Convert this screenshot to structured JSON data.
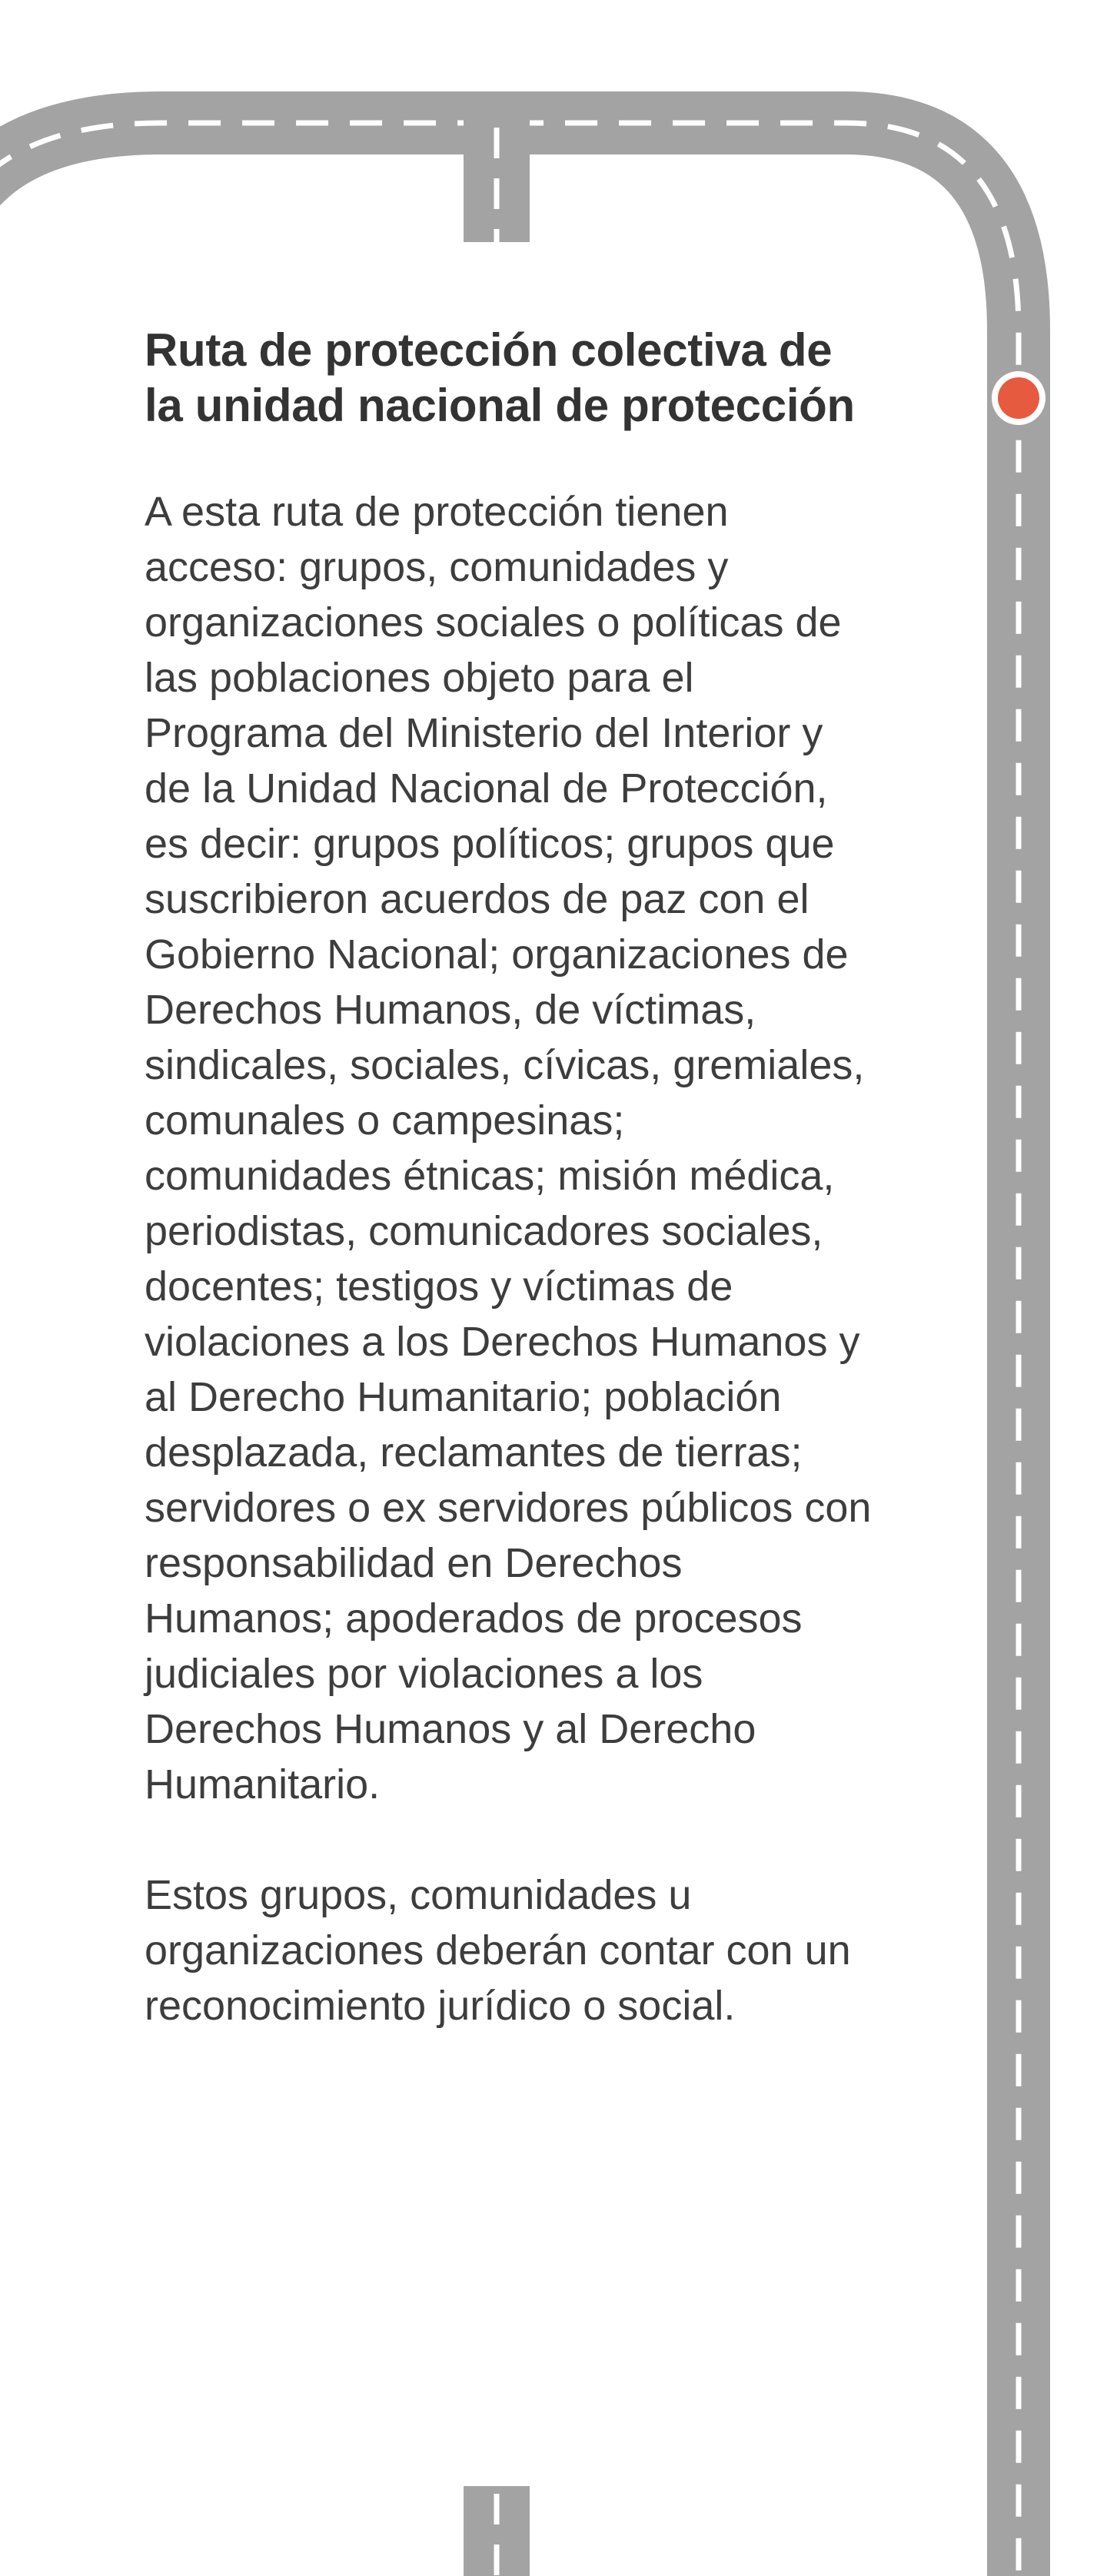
{
  "section": {
    "title": "Ruta de protección colectiva de la unidad nacional de protección",
    "paragraphs": [
      "A esta ruta de protección tienen acceso: grupos, comunidades y organizaciones sociales o políticas de las poblaciones objeto para el Programa del Ministerio del Interior y de la Unidad Nacional de Protección, es decir: grupos políticos; grupos que suscribieron acuerdos de paz con el Gobierno Nacional; organizaciones de Derechos Humanos, de víctimas, sindicales, sociales, cívicas, gremiales, comunales o campesinas; comunidades étnicas; misión médica, periodistas, comunicadores sociales, docentes; testigos y víctimas de violaciones a los Derechos Humanos y al Derecho Humanitario; población desplazada, reclamantes de tierras; servidores o ex servidores públicos con responsabilidad en Derechos Humanos; apoderados de procesos judiciales por violaciones a los Derechos Humanos y al Derecho Humanitario.",
      "Estos grupos, comunidades u organizaciones deberán contar con un reconocimiento jurídico o social."
    ]
  },
  "decoration": {
    "road_color": "#a3a3a3",
    "lane_marking_color": "#ffffff",
    "marker_color": "#e65a3f",
    "background_color": "#ffffff"
  }
}
